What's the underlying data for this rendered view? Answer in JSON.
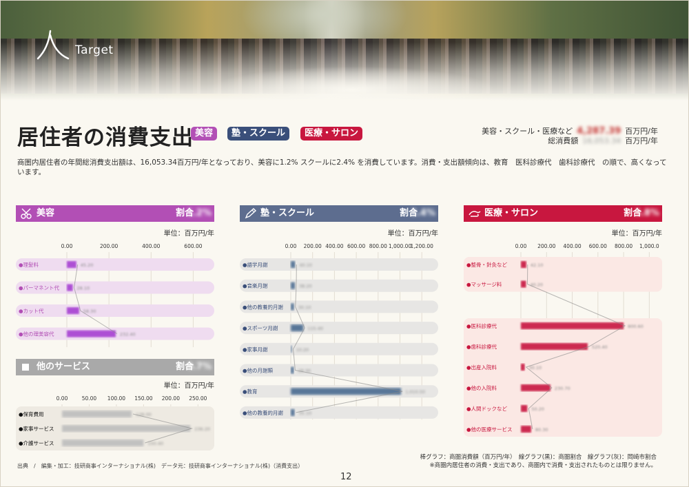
{
  "header": {
    "logo_text": "Target",
    "title": "居住者の消費支出",
    "badges": [
      "美容",
      "塾・スクール",
      "医療・サロン"
    ],
    "summary": {
      "label1": "美容・スクール・医療など",
      "label2": "総消費額",
      "value1": "4,287.39",
      "value2": "16,053.34",
      "unit1": "百万円/年",
      "unit2": "百万円/年"
    },
    "description": "商圏内居住者の年間総消費支出額は、16,053.34百万円/年となっており、美容に1.2% スクールに2.4% を消費しています。消費・支出額傾向は、教育　医科診療代　歯科診療代　の順で、高くなっています。",
    "colors": {
      "beauty": "#b24fb5",
      "school": "#3a4f7a",
      "medical": "#c8173f",
      "other": "#a9a9a9"
    }
  },
  "panels": {
    "beauty": {
      "title": "美容",
      "ratio_label": "割合",
      "ratio_value": "1.2%",
      "unit": "単位：百万円/年",
      "icon": "scissors-icon",
      "chart_data": {
        "type": "bar",
        "categories": [
          "●理髪料",
          "●パーマネント代",
          "●カット代",
          "●他の理美容代"
        ],
        "values": [
          45,
          28,
          58,
          232
        ],
        "value_labels": [
          "45.20",
          "28.10",
          "58.30",
          "232.40"
        ],
        "xlim": [
          0,
          700
        ],
        "ticks": [
          "0.00",
          "200.00",
          "400.00",
          "600.00"
        ]
      }
    },
    "other": {
      "title": "他のサービス",
      "ratio_label": "割合",
      "ratio_value": "0.7%",
      "unit": "単位：百万円/年",
      "icon": "square-icon",
      "chart_data": {
        "type": "bar",
        "categories": [
          "●保育費用",
          "●家事サービス",
          "●介護サービス"
        ],
        "values": [
          128,
          236,
          150
        ],
        "value_labels": [
          "128.00",
          "236.20",
          "150.40"
        ],
        "xlim": [
          0,
          280
        ],
        "ticks": [
          "0.00",
          "50.00",
          "100.00",
          "150.00",
          "200.00",
          "250.00"
        ]
      }
    },
    "school": {
      "title": "塾・スクール",
      "ratio_label": "割合",
      "ratio_value": "2.4%",
      "unit": "単位：百万円/年",
      "icon": "pencil-icon",
      "chart_data": {
        "type": "bar",
        "categories": [
          "●語学月謝",
          "●音楽月謝",
          "●他の教養的月謝",
          "●スポーツ月謝",
          "●家事月謝",
          "●他の月謝類",
          "●教育",
          "●他の教養的月謝"
        ],
        "values": [
          40,
          38,
          30,
          115,
          10,
          28,
          1010,
          35
        ],
        "value_labels": [
          "40.10",
          "38.20",
          "30.10",
          "115.40",
          "10.20",
          "28.30",
          "1,010.50",
          "35.10"
        ],
        "xlim": [
          0,
          1350
        ],
        "ticks": [
          "0.00",
          "200.00",
          "400.00",
          "600.00",
          "800.00",
          "1,000.00",
          "1,200.00"
        ]
      }
    },
    "medical": {
      "title": "医療・サロン",
      "ratio_label": "割合",
      "ratio_value": "3.8%",
      "unit": "単位：百万円/年",
      "icon": "hand-icon",
      "chart_data": {
        "type": "bar",
        "categories": [
          "●整骨・針灸など",
          "●マッサージ料",
          "●医科診療代",
          "●歯科診療代",
          "●出産入院料",
          "●他の入院料",
          "●人間ドックなど",
          "●他の医療サービス"
        ],
        "values": [
          42,
          40,
          800,
          520,
          30,
          230,
          50,
          80
        ],
        "value_labels": [
          "42.10",
          "40.20",
          "800.60",
          "520.40",
          "30.10",
          "230.70",
          "50.20",
          "80.30"
        ],
        "xlim": [
          0,
          1100
        ],
        "ticks": [
          "0.00",
          "200.00",
          "400.00",
          "600.00",
          "800.00",
          "1,000.0"
        ]
      }
    }
  },
  "footer": {
    "source": "出典　/　編集・加工：技研商事インターナショナル(株)　データ元：技研商事インターナショナル(株)（消費支出）",
    "legend": "棒グラフ：商圏消費額（百万円/年）　線グラフ(黒)：商圏割合　線グラフ(灰)：岡崎市割合",
    "note": "※商圏内居住者の消費・支出であり、商圏内で消費・支出されたものとは限りません。",
    "page": "12"
  }
}
